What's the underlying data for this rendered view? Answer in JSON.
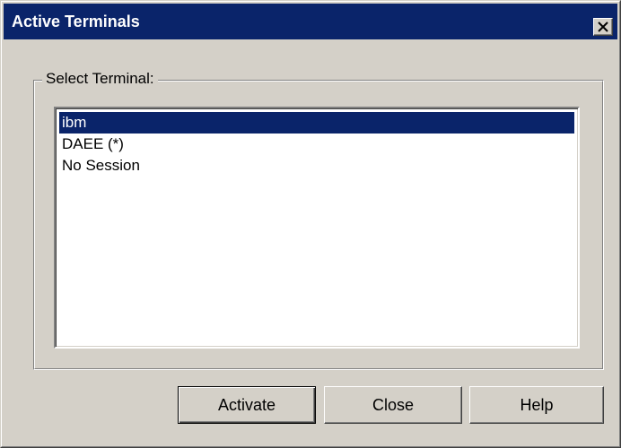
{
  "window": {
    "title": "Active Terminals",
    "close_icon": "close-x-icon"
  },
  "group": {
    "label": "Select Terminal:"
  },
  "terminals": {
    "items": [
      {
        "label": "ibm",
        "selected": true
      },
      {
        "label": "DAEE (*)",
        "selected": false
      },
      {
        "label": "No Session",
        "selected": false
      }
    ]
  },
  "buttons": {
    "activate": "Activate",
    "close": "Close",
    "help": "Help"
  },
  "colors": {
    "titlebar": "#0a246a",
    "face": "#d4d0c8",
    "selection": "#0a246a"
  }
}
